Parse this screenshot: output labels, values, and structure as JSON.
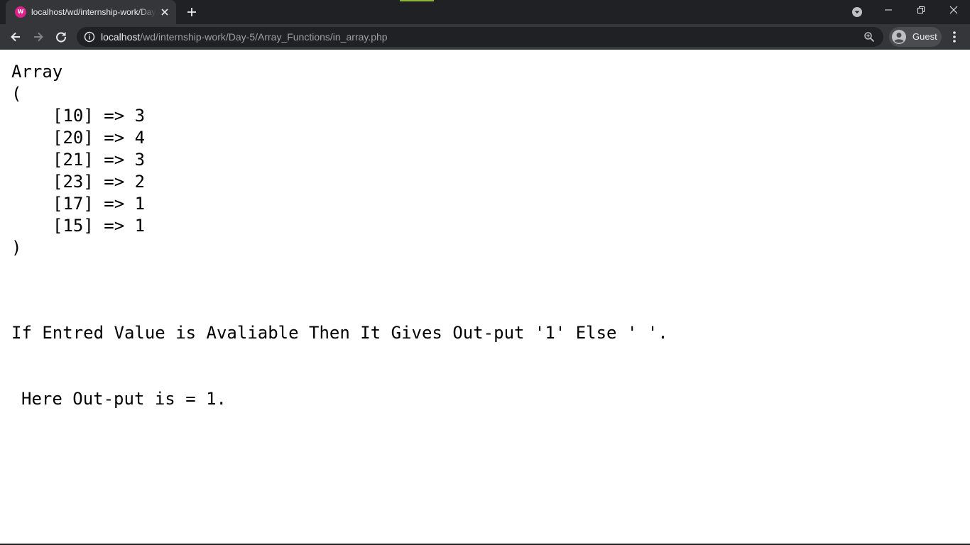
{
  "browser": {
    "tab": {
      "title": "localhost/wd/internship-work/Day-5/Array_Functions/in_array.php",
      "favicon_label": "W"
    },
    "address_bar": {
      "host": "localhost",
      "path": "/wd/internship-work/Day-5/Array_Functions/in_array.php"
    },
    "profile": {
      "label": "Guest"
    },
    "colors": {
      "frame": "#202124",
      "toolbar": "#35363a",
      "favicon": "#e0218a",
      "accent": "#8ab436"
    },
    "icons": [
      "favicon-icon",
      "close-icon",
      "plus-icon",
      "tab-search-icon",
      "minimize-icon",
      "maximize-icon",
      "close-window-icon",
      "back-arrow-icon",
      "forward-arrow-icon",
      "reload-icon",
      "info-icon",
      "zoom-icon",
      "avatar-icon",
      "more-vertical-icon"
    ]
  },
  "page": {
    "array_output": {
      "header": "Array",
      "open": "(",
      "items": [
        {
          "key": "[10]",
          "arrow": "=>",
          "value": "3"
        },
        {
          "key": "[20]",
          "arrow": "=>",
          "value": "4"
        },
        {
          "key": "[21]",
          "arrow": "=>",
          "value": "3"
        },
        {
          "key": "[23]",
          "arrow": "=>",
          "value": "2"
        },
        {
          "key": "[17]",
          "arrow": "=>",
          "value": "1"
        },
        {
          "key": "[15]",
          "arrow": "=>",
          "value": "1"
        }
      ],
      "close": ")"
    },
    "message": {
      "line1": "If Entred Value is Avaliable Then It Gives Out-put '1' Else ' '.",
      "line2": "Here Out-put is = 1."
    }
  }
}
